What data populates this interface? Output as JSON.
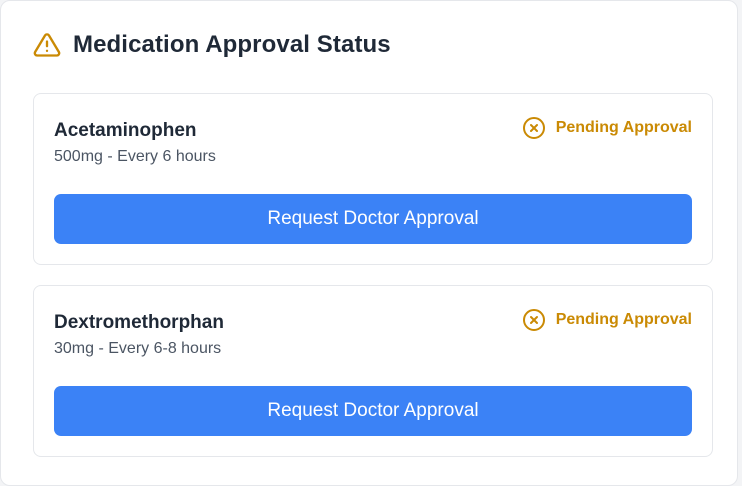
{
  "header": {
    "icon": "warning-triangle-icon",
    "title": "Medication Approval Status"
  },
  "colors": {
    "warning": "#ca8a04",
    "button": "#3b82f6"
  },
  "medications": [
    {
      "name": "Acetaminophen",
      "dosage": "500mg - Every 6 hours",
      "status_icon": "x-circle-icon",
      "status": "Pending Approval",
      "action_label": "Request Doctor Approval"
    },
    {
      "name": "Dextromethorphan",
      "dosage": "30mg - Every 6-8 hours",
      "status_icon": "x-circle-icon",
      "status": "Pending Approval",
      "action_label": "Request Doctor Approval"
    }
  ]
}
